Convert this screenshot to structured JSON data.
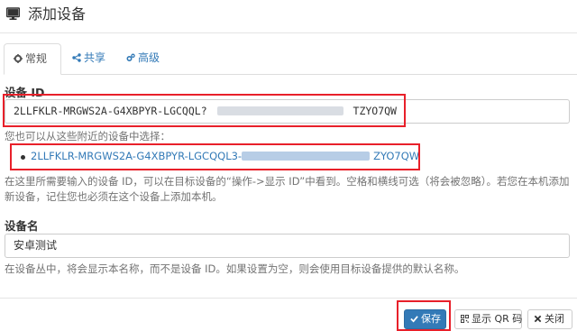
{
  "dialog": {
    "title": "添加设备",
    "icon": "monitor-icon"
  },
  "tabs": [
    {
      "label": "常规",
      "icon": "gear-icon",
      "active": true
    },
    {
      "label": "共享",
      "icon": "share-icon",
      "active": false
    },
    {
      "label": "高级",
      "icon": "cogs-icon",
      "active": false
    }
  ],
  "device_id": {
    "label": "设备 ID",
    "value_prefix": "2LLFKLR-MRGWS2A-G4XBPYR-LGCQQL?",
    "value_suffix": "TZYO7QW",
    "nearby_hint": "您也可以从这些附近的设备中选择：",
    "nearby_device_prefix": "2LLFKLR-MRGWS2A-G4XBPYR-LGCQQL3-",
    "nearby_device_suffix": "ZYO7QW",
    "help_text": "在这里所需要输入的设备 ID，可以在目标设备的“操作->显示 ID”中看到。空格和横线可选（将会被忽略）。若您在本机添加新设备，记住您也必须在这个设备上添加本机。"
  },
  "device_name": {
    "label": "设备名",
    "value": "安卓测试",
    "help_text": "在设备丛中，将会显示本名称，而不是设备 ID。如果设置为空，则会使用目标设备提供的默认名称。"
  },
  "footer": {
    "save_label": "保存",
    "show_qr_label": "显示 QR 码",
    "close_label": "关闭"
  },
  "colors": {
    "accent": "#337ab7",
    "highlight": "#e8202a"
  }
}
